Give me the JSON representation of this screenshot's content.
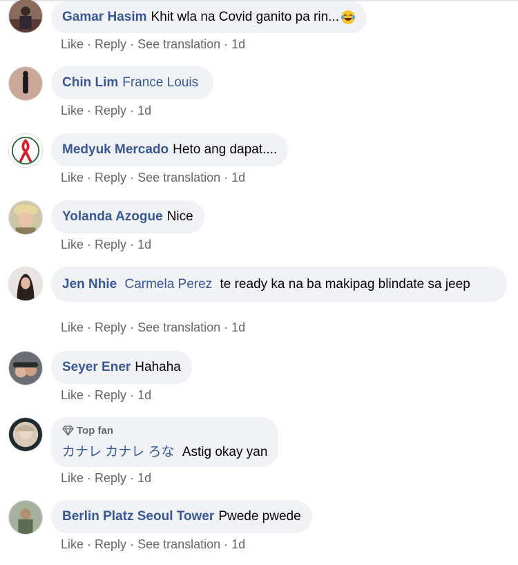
{
  "actions": {
    "like": "Like",
    "reply": "Reply",
    "see_translation": "See translation",
    "dot": "·",
    "time": "1d"
  },
  "comments": [
    {
      "name": "Gamar Hasim",
      "text": "Khit wla na Covid ganito pa rin...",
      "emoji": "laughing-tears-emoji"
    },
    {
      "name": "Chin Lim",
      "tag": "France Louis"
    },
    {
      "name": "Medyuk Mercado",
      "text": "Heto ang dapat...."
    },
    {
      "name": "Yolanda Azogue",
      "text": "Nice"
    },
    {
      "name": "Jen Nhie",
      "tag": "Carmela Perez",
      "text": "te ready ka na ba makipag blindate sa jeep"
    },
    {
      "name": "Seyer Ener",
      "text": "Hahaha"
    },
    {
      "badge": "Top fan",
      "name": "カナレ カナレ ろな",
      "text": "Astig okay yan"
    },
    {
      "name": "Berlin Platz Seoul Tower",
      "text": "Pwede pwede"
    }
  ],
  "colors": {
    "name": "#385898",
    "meta": "#65676b",
    "bubble": "#f0f2f5",
    "text": "#050505"
  }
}
